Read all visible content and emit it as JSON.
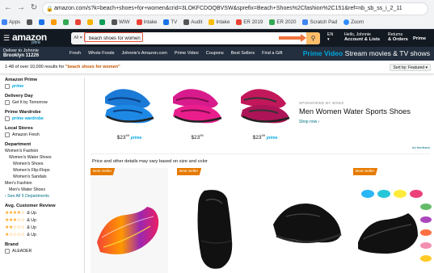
{
  "browser": {
    "url": "amazon.com/s?k=beach+shoes+for+women&crid=3LOKFCDOQBVSW&sprefix=Beach+Shoes%2Cfashion%2C151&ref=nb_sb_ss_i_2_11",
    "bookmarks": [
      {
        "label": "Apps",
        "color": "#4285f4"
      },
      {
        "label": "",
        "color": "#555"
      },
      {
        "label": "",
        "color": "#1a73e8"
      },
      {
        "label": "",
        "color": "#ff9900"
      },
      {
        "label": "",
        "color": "#34a853"
      },
      {
        "label": "",
        "color": "#ea4335"
      },
      {
        "label": "",
        "color": "#f4b400"
      },
      {
        "label": "",
        "color": "#0f9d58"
      },
      {
        "label": "",
        "color": "#ab47bc"
      },
      {
        "label": "WIW",
        "color": "#555"
      },
      {
        "label": "Intake",
        "color": "#ea4335"
      },
      {
        "label": "TV",
        "color": "#1a73e8"
      },
      {
        "label": "Audit",
        "color": "#555"
      },
      {
        "label": "Intake",
        "color": "#fbbc04"
      },
      {
        "label": "ER 2019",
        "color": "#ea4335"
      },
      {
        "label": "ER 2020",
        "color": "#34a853"
      },
      {
        "label": "Scratch Pad",
        "color": "#4285f4"
      },
      {
        "label": "Zoom",
        "color": "#2d8cff"
      }
    ]
  },
  "header": {
    "logo": "amazon",
    "logo_sub": "prime",
    "search_category": "All",
    "search_value": "beach shoes for women",
    "lang": "EN",
    "account_line1": "Hello, Johnnie",
    "account_line2": "Account & Lists",
    "orders_line1": "Returns",
    "orders_line2": "& Orders",
    "prime_label": "Prime"
  },
  "subheader": {
    "deliver_line1": "Deliver to Johnnie",
    "deliver_line2": "Brooklyn 11226",
    "nav": [
      "Fresh",
      "Whole Foods",
      "Johnnie's Amazon.com",
      "Prime Video",
      "Coupons",
      "Best Sellers",
      "Find a Gift"
    ],
    "promo_brand": "Prime Video",
    "promo_text": "Stream movies & TV shows"
  },
  "results": {
    "count_text": "1-48 of over 10,000 results for",
    "query": "\"beach shoes for women\"",
    "sort": "Sort by: Featured"
  },
  "sidebar": {
    "amazon_prime_h": "Amazon Prime",
    "prime_label": "prime",
    "delivery_h": "Delivery Day",
    "delivery_item": "Get It by Tomorrow",
    "wardrobe_h": "Prime Wardrobe",
    "wardrobe_item": "prime wardrobe",
    "local_h": "Local Stores",
    "local_item": "Amazon Fresh",
    "dept_h": "Department",
    "dept_items": [
      "Women's Fashion",
      "Women's Water Shoes",
      "Women's Shoes",
      "Women's Flip-Flops",
      "Women's Sandals",
      "Men's Fashion",
      "Men's Water Shoes"
    ],
    "see_all": "‹ See All 5 Departments",
    "review_h": "Avg. Customer Review",
    "stars": [
      "★★★★☆",
      "★★★☆☆",
      "★★☆☆☆",
      "★☆☆☆☆"
    ],
    "and_up": "& Up",
    "brand_h": "Brand",
    "brand_item": "ALEADER"
  },
  "banner": {
    "prices": [
      {
        "dollars": "23",
        "cents": "99"
      },
      {
        "dollars": "23",
        "cents": "99"
      },
      {
        "dollars": "23",
        "cents": "99"
      }
    ],
    "prime_tag": "prime",
    "sponsored": "SPONSORED BY WXDZ",
    "title": "Men Women Water Sports Shoes",
    "shop_now": "Shop now ›",
    "ad_feedback": "Ad feedback"
  },
  "price_note": "Price and other details may vary based on size and color",
  "products": [
    {
      "badge": "Best Seller"
    },
    {
      "badge": "Best Seller"
    },
    {
      "badge": ""
    },
    {
      "badge": "Best Seller"
    }
  ]
}
